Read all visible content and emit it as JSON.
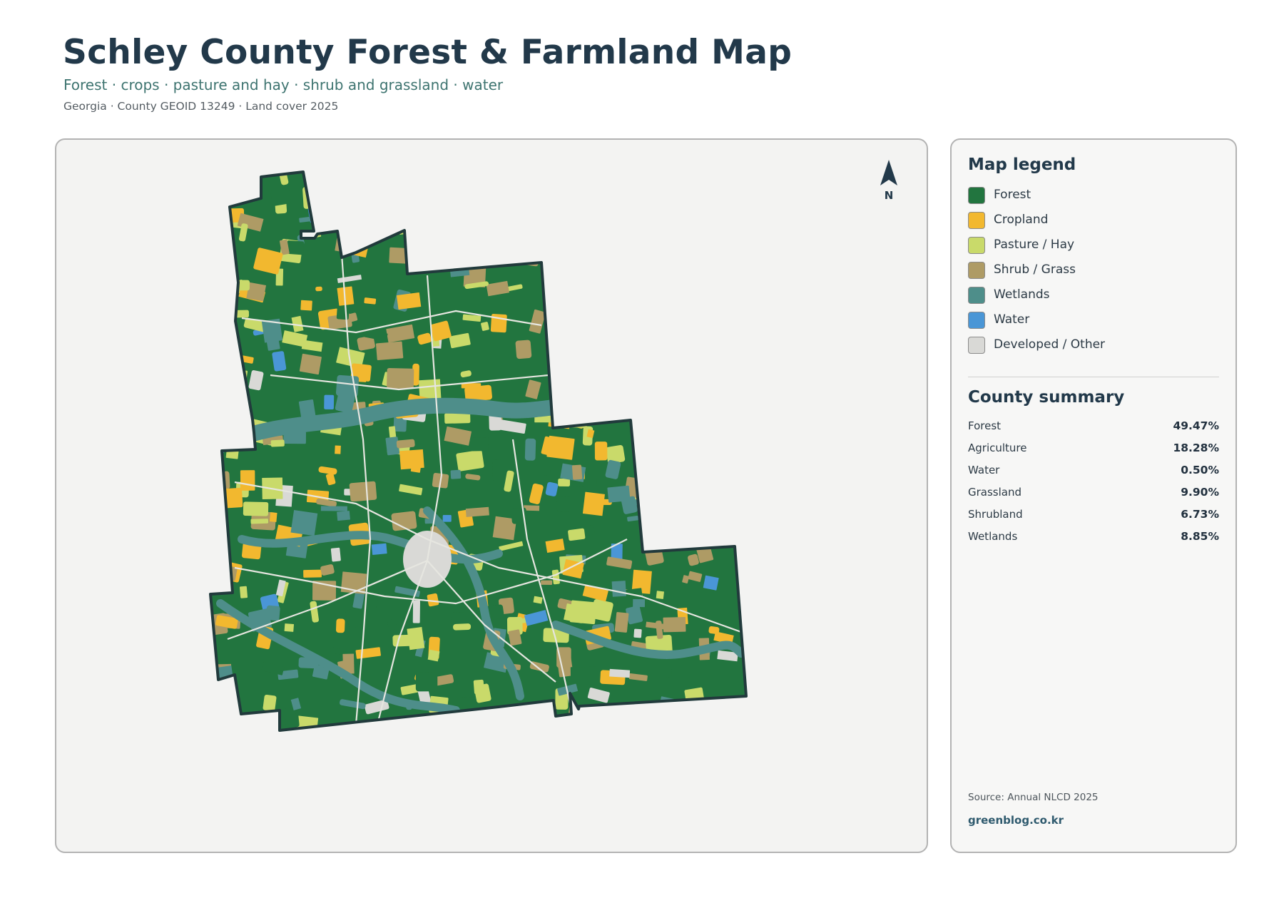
{
  "header": {
    "title": "Schley County Forest & Farmland Map",
    "subtitle": "Forest · crops · pasture and hay · shrub and grassland · water",
    "meta": "Georgia · County GEOID 13249 · Land cover 2025"
  },
  "map": {
    "north_label": "N",
    "colors": {
      "forest": "#22753f",
      "cropland": "#f2b82f",
      "pasture": "#c9da6a",
      "shrub": "#ae9b65",
      "wetlands": "#4e8e8a",
      "water": "#4a96d6",
      "developed": "#d9d9d6",
      "outline": "#213a3c",
      "roads": "#e6e6e0"
    }
  },
  "legend": {
    "heading": "Map legend",
    "items": [
      {
        "label": "Forest",
        "color": "#22753f"
      },
      {
        "label": "Cropland",
        "color": "#f2b82f"
      },
      {
        "label": "Pasture / Hay",
        "color": "#c9da6a"
      },
      {
        "label": "Shrub / Grass",
        "color": "#ae9b65"
      },
      {
        "label": "Wetlands",
        "color": "#4e8e8a"
      },
      {
        "label": "Water",
        "color": "#4a96d6"
      },
      {
        "label": "Developed / Other",
        "color": "#d9d9d6"
      }
    ]
  },
  "summary": {
    "heading": "County summary",
    "rows": [
      {
        "label": "Forest",
        "value": "49.47%"
      },
      {
        "label": "Agriculture",
        "value": "18.28%"
      },
      {
        "label": "Water",
        "value": "0.50%"
      },
      {
        "label": "Grassland",
        "value": "9.90%"
      },
      {
        "label": "Shrubland",
        "value": "6.73%"
      },
      {
        "label": "Wetlands",
        "value": "8.85%"
      }
    ]
  },
  "footer": {
    "source": "Source: Annual NLCD 2025",
    "brand": "greenblog.co.kr"
  }
}
